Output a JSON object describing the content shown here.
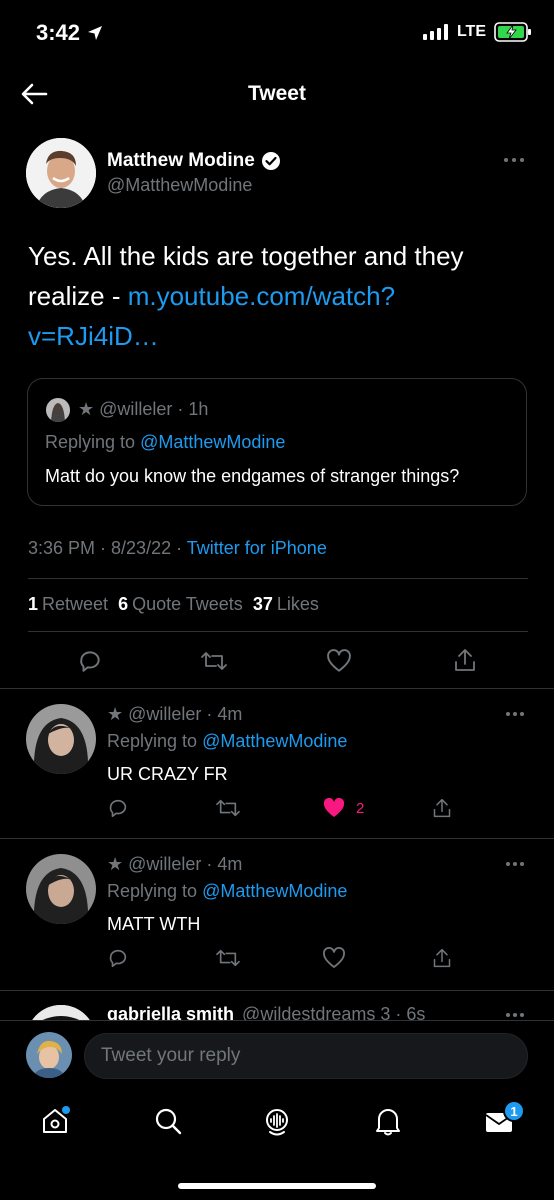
{
  "status_bar": {
    "time": "3:42",
    "network": "LTE"
  },
  "header": {
    "title": "Tweet"
  },
  "main_tweet": {
    "author_name": "Matthew Modine",
    "author_handle": "@MatthewModine",
    "text_plain": "Yes. All the kids are together and they realize - ",
    "link_text": "m.youtube.com/watch?v=RJi4iD…",
    "link_line1": "m.youtube.com/watch?",
    "link_line2": "v=RJi4iD…",
    "quoted": {
      "meta": "★ @willeler · 1h",
      "replying_prefix": "Replying to ",
      "replying_handle": "@MatthewModine",
      "text": "Matt do you know the endgames of stranger things?"
    },
    "timestamp_prefix": "3:36 PM · 8/23/22 · ",
    "source": "Twitter for iPhone",
    "stats": {
      "retweets_count": "1",
      "retweets_label": "Retweet",
      "quotes_count": "6",
      "quotes_label": "Quote Tweets",
      "likes_count": "37",
      "likes_label": "Likes"
    }
  },
  "replies": [
    {
      "meta": "★ @willeler · 4m",
      "replying_prefix": "Replying to ",
      "replying_handle": "@MatthewModine",
      "text": "UR CRAZY FR",
      "like_count": "2",
      "liked": true
    },
    {
      "meta": "★ @willeler · 4m",
      "replying_prefix": "Replying to ",
      "replying_handle": "@MatthewModine",
      "text": "MATT WTH",
      "like_count": "",
      "liked": false
    },
    {
      "name": "gabriella smith",
      "meta": "@wildestdreams 3 · 6s"
    }
  ],
  "composer": {
    "placeholder": "Tweet your reply"
  },
  "tab_bar": {
    "items": [
      "home",
      "search",
      "spaces",
      "notifications",
      "messages"
    ],
    "messages_badge": "1"
  },
  "colors": {
    "accent": "#1d9bf0",
    "like": "#f91880",
    "background": "#000000"
  }
}
